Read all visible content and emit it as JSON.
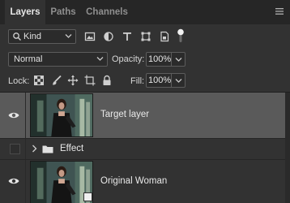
{
  "tabs": [
    {
      "label": "Layers",
      "active": true
    },
    {
      "label": "Paths",
      "active": false
    },
    {
      "label": "Channels",
      "active": false
    }
  ],
  "filter": {
    "kind_label": "Kind",
    "icons": [
      "pixel-layer-filter-icon",
      "adjustment-layer-filter-icon",
      "type-layer-filter-icon",
      "shape-layer-filter-icon",
      "smart-object-filter-icon"
    ]
  },
  "blend": {
    "mode": "Normal",
    "opacity_label": "Opacity:",
    "opacity_value": "100%"
  },
  "lock": {
    "label": "Lock:",
    "icons": [
      "lock-transparent-pixels-icon",
      "lock-image-pixels-icon",
      "lock-position-icon",
      "lock-artboard-icon",
      "lock-all-icon"
    ],
    "fill_label": "Fill:",
    "fill_value": "100%"
  },
  "layers": [
    {
      "name": "Target layer",
      "visible": true,
      "selected": true,
      "type": "pixel"
    },
    {
      "name": "Effect",
      "visible": false,
      "selected": false,
      "type": "group",
      "collapsed": true
    },
    {
      "name": "Original Woman",
      "visible": true,
      "selected": false,
      "type": "smart-object"
    }
  ],
  "colors": {
    "panel_bg": "#323232",
    "tabbar_bg": "#262626",
    "selected_row": "#5a5a5a"
  }
}
